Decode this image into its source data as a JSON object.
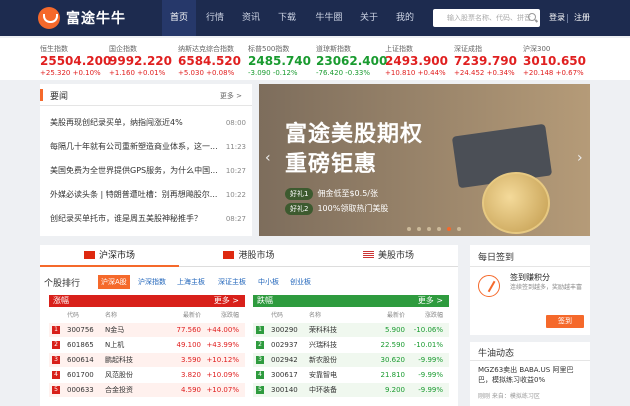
{
  "brand": "富途牛牛",
  "nav": [
    "首页",
    "行情",
    "资讯",
    "下载",
    "牛牛圈",
    "关于",
    "我的"
  ],
  "search": {
    "placeholder": "输入股票名称、代码、拼音"
  },
  "user": {
    "login": "登录",
    "register": "注册"
  },
  "indices": [
    {
      "name": "恒生指数",
      "value": "25504.200",
      "change": "+25.320",
      "pct": "+0.10%",
      "dir": "up"
    },
    {
      "name": "国企指数",
      "value": "9992.220",
      "change": "+1.160",
      "pct": "+0.01%",
      "dir": "up"
    },
    {
      "name": "纳斯达克综合指数",
      "value": "6584.520",
      "change": "+5.030",
      "pct": "+0.08%",
      "dir": "up"
    },
    {
      "name": "标普500指数",
      "value": "2485.740",
      "change": "-3.090",
      "pct": "-0.12%",
      "dir": "down"
    },
    {
      "name": "道琼斯指数",
      "value": "23062.400",
      "change": "-76.420",
      "pct": "-0.33%",
      "dir": "down"
    },
    {
      "name": "上证指数",
      "value": "2493.900",
      "change": "+10.810",
      "pct": "+0.44%",
      "dir": "up"
    },
    {
      "name": "深证成指",
      "value": "7239.790",
      "change": "+24.452",
      "pct": "+0.34%",
      "dir": "up"
    },
    {
      "name": "沪深300",
      "value": "3010.650",
      "change": "+20.148",
      "pct": "+0.67%",
      "dir": "up"
    }
  ],
  "news": {
    "title": "要闻",
    "more": "更多 >",
    "items": [
      {
        "text": "美股再现创纪录买单，纳指闯涨近4%",
        "time": "08:00"
      },
      {
        "text": "每隔几十年就有公司重新塑造商业体系，这一...",
        "time": "11:23"
      },
      {
        "text": "美国免费为全世界提供GPS服务，为什么中国...",
        "time": "10:27"
      },
      {
        "text": "外媒必读头条 | 特朗普遭吐槽：别再想飚股尔...",
        "time": "10:22"
      },
      {
        "text": "创纪录买单托市，谁是周五美股神秘推手？",
        "time": "08:27"
      }
    ]
  },
  "banner": {
    "title1": "富途美股期权",
    "title2": "重磅钜惠",
    "gift1": "好礼1",
    "line1": "佣金低至$0.5/张",
    "gift2": "好礼2",
    "line2": "100%领取热门美股"
  },
  "market": {
    "tabs": [
      "沪深市场",
      "港股市场",
      "美股市场"
    ],
    "rank_title": "个股排行",
    "subtabs": [
      "沪深A股",
      "沪深指数",
      "上海主板",
      "深证主板",
      "中小板",
      "创业板"
    ],
    "gainers": {
      "title": "涨幅",
      "more": "更多 >",
      "cols": [
        "代码",
        "名称",
        "最新价",
        "涨跌幅"
      ],
      "rows": [
        {
          "rank": "1",
          "code": "300756",
          "name": "N金马",
          "price": "77.560",
          "pct": "+44.00%"
        },
        {
          "rank": "2",
          "code": "601865",
          "name": "N上机",
          "price": "49.100",
          "pct": "+43.99%"
        },
        {
          "rank": "3",
          "code": "600614",
          "name": "鹏起科技",
          "price": "3.590",
          "pct": "+10.12%"
        },
        {
          "rank": "4",
          "code": "601700",
          "name": "风范股份",
          "price": "3.820",
          "pct": "+10.09%"
        },
        {
          "rank": "5",
          "code": "000633",
          "name": "合金投资",
          "price": "4.590",
          "pct": "+10.07%"
        }
      ]
    },
    "losers": {
      "title": "跌幅",
      "more": "更多 >",
      "cols": [
        "代码",
        "名称",
        "最新价",
        "涨跌幅"
      ],
      "rows": [
        {
          "rank": "1",
          "code": "300290",
          "name": "荣科科技",
          "price": "5.900",
          "pct": "-10.06%"
        },
        {
          "rank": "2",
          "code": "002937",
          "name": "兴瑞科技",
          "price": "22.590",
          "pct": "-10.01%"
        },
        {
          "rank": "3",
          "code": "002942",
          "name": "新农股份",
          "price": "30.620",
          "pct": "-9.99%"
        },
        {
          "rank": "4",
          "code": "300617",
          "name": "安靠智电",
          "price": "21.810",
          "pct": "-9.99%"
        },
        {
          "rank": "5",
          "code": "300140",
          "name": "中环装备",
          "price": "9.200",
          "pct": "-9.99%"
        }
      ]
    }
  },
  "signin": {
    "title": "每日签到",
    "subtitle": "签到赚积分",
    "desc": "连续签到越多，奖励越丰富",
    "button": "签到"
  },
  "feed": {
    "title": "牛油动态",
    "text": "MGZ63卖出 BABA.US 阿里巴巴，模拟练习收益0%",
    "meta": "刚刚 来自：模拟练习区"
  }
}
